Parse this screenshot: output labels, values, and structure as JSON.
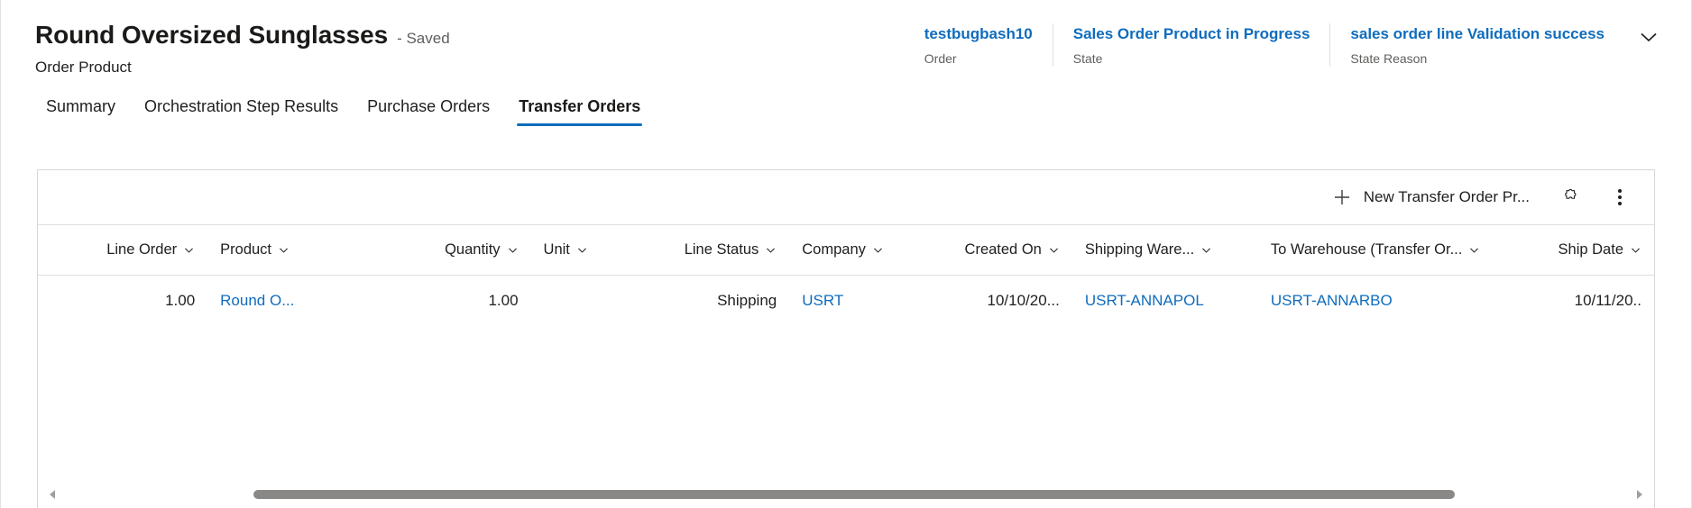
{
  "header": {
    "record_title": "Round Oversized Sunglasses",
    "save_state": "- Saved",
    "entity_name": "Order Product",
    "chevron_icon": "chevron-down-icon",
    "fields": [
      {
        "value": "testbugbash10",
        "label": "Order"
      },
      {
        "value": "Sales Order Product in Progress",
        "label": "State"
      },
      {
        "value": "sales order line Validation success",
        "label": "State Reason"
      }
    ]
  },
  "tabs": [
    {
      "label": "Summary",
      "active": false
    },
    {
      "label": "Orchestration Step Results",
      "active": false
    },
    {
      "label": "Purchase Orders",
      "active": false
    },
    {
      "label": "Transfer Orders",
      "active": true
    }
  ],
  "toolbar": {
    "new_label": "New Transfer Order Pr...",
    "plus_icon": "plus-icon",
    "puzzle_icon": "puzzle-piece-icon",
    "overflow_icon": "more-vertical-icon"
  },
  "grid": {
    "columns": [
      {
        "label": "Line Order",
        "align": "right"
      },
      {
        "label": "Product",
        "align": "left"
      },
      {
        "label": "Quantity",
        "align": "right"
      },
      {
        "label": "Unit",
        "align": "left"
      },
      {
        "label": "Line Status",
        "align": "right"
      },
      {
        "label": "Company",
        "align": "left"
      },
      {
        "label": "Created On",
        "align": "right"
      },
      {
        "label": "Shipping Ware...",
        "align": "left"
      },
      {
        "label": "To Warehouse (Transfer Or...",
        "align": "left"
      },
      {
        "label": "Ship Date",
        "align": "right"
      }
    ],
    "rows": [
      {
        "line_order": "1.00",
        "product": "Round O...",
        "quantity": "1.00",
        "unit": "",
        "line_status": "Shipping",
        "company": "USRT",
        "created_on": "10/10/20...",
        "shipping_warehouse": "USRT-ANNAPOL",
        "to_warehouse": "USRT-ANNARBO",
        "ship_date": "10/11/20.."
      }
    ]
  },
  "scrollbar": {
    "left_arrow_icon": "scroll-left-arrow-icon",
    "right_arrow_icon": "scroll-right-arrow-icon"
  },
  "colors": {
    "link": "#0f6cbd",
    "accent": "#0f6cbd",
    "text": "#201f1e",
    "muted": "#605e5c"
  }
}
